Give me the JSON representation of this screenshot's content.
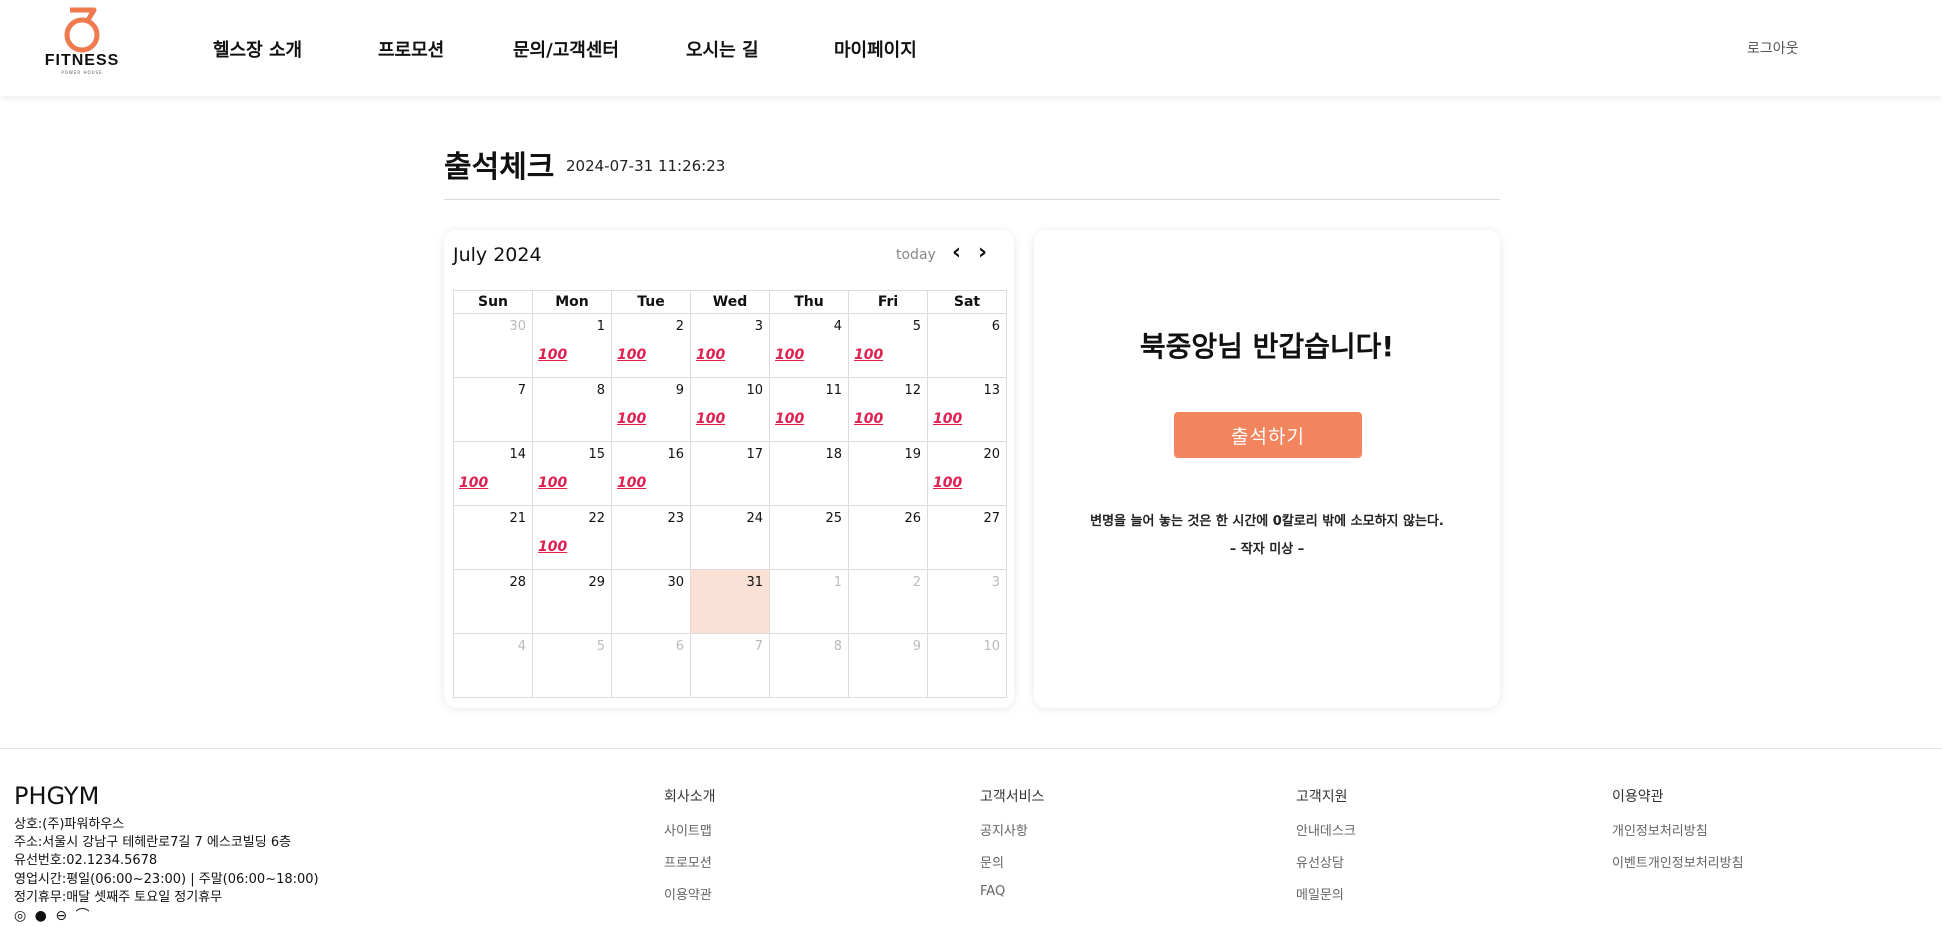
{
  "header": {
    "logo_text": "FITNESS",
    "logo_sub": "POWER HOUSE",
    "nav": [
      "헬스장 소개",
      "프로모션",
      "문의/고객센터",
      "오시는 길",
      "마이페이지"
    ],
    "logout": "로그아웃"
  },
  "page": {
    "title": "출석체크",
    "datetime": "2024-07-31 11:26:23"
  },
  "calendar": {
    "month_label": "July 2024",
    "today_label": "today",
    "prev_icon": "‹",
    "next_icon": "›",
    "weekdays": [
      "Sun",
      "Mon",
      "Tue",
      "Wed",
      "Thu",
      "Fri",
      "Sat"
    ],
    "stamp_text": "100",
    "weeks": [
      [
        {
          "d": "30",
          "o": true
        },
        {
          "d": "1",
          "s": true
        },
        {
          "d": "2",
          "s": true
        },
        {
          "d": "3",
          "s": true
        },
        {
          "d": "4",
          "s": true
        },
        {
          "d": "5",
          "s": true
        },
        {
          "d": "6"
        }
      ],
      [
        {
          "d": "7"
        },
        {
          "d": "8"
        },
        {
          "d": "9",
          "s": true
        },
        {
          "d": "10",
          "s": true
        },
        {
          "d": "11",
          "s": true
        },
        {
          "d": "12",
          "s": true
        },
        {
          "d": "13",
          "s": true
        }
      ],
      [
        {
          "d": "14",
          "s": true
        },
        {
          "d": "15",
          "s": true
        },
        {
          "d": "16",
          "s": true
        },
        {
          "d": "17"
        },
        {
          "d": "18"
        },
        {
          "d": "19"
        },
        {
          "d": "20",
          "s": true
        }
      ],
      [
        {
          "d": "21"
        },
        {
          "d": "22",
          "s": true
        },
        {
          "d": "23"
        },
        {
          "d": "24"
        },
        {
          "d": "25"
        },
        {
          "d": "26"
        },
        {
          "d": "27"
        }
      ],
      [
        {
          "d": "28"
        },
        {
          "d": "29"
        },
        {
          "d": "30"
        },
        {
          "d": "31",
          "t": true
        },
        {
          "d": "1",
          "o": true
        },
        {
          "d": "2",
          "o": true
        },
        {
          "d": "3",
          "o": true
        }
      ],
      [
        {
          "d": "4",
          "o": true
        },
        {
          "d": "5",
          "o": true
        },
        {
          "d": "6",
          "o": true
        },
        {
          "d": "7",
          "o": true
        },
        {
          "d": "8",
          "o": true
        },
        {
          "d": "9",
          "o": true
        },
        {
          "d": "10",
          "o": true
        }
      ]
    ]
  },
  "greeting": {
    "title": "북중앙님 반갑습니다!",
    "button": "출석하기",
    "quote": "변명을 늘어 놓는 것은 한 시간에 0칼로리 밖에 소모하지 않는다.",
    "author": "– 작자 미상 –"
  },
  "footer": {
    "brand": "PHGYM",
    "info": [
      "상호:(주)파워하우스",
      "주소:서울시 강남구 테헤란로7길 7 에스코빌딩 6층",
      "유선번호:02.1234.5678",
      "영업시간:평일(06:00~23:00) | 주말(06:00~18:00)",
      "정기휴무:매달 셋째주 토요일 정기휴무"
    ],
    "social_icons": [
      "instagram-icon",
      "github-icon",
      "car-icon",
      "bird-icon"
    ],
    "columns": [
      {
        "title": "회사소개",
        "links": [
          "사이트맵",
          "프로모션",
          "이용약관"
        ]
      },
      {
        "title": "고객서비스",
        "links": [
          "공지사항",
          "문의",
          "FAQ"
        ]
      },
      {
        "title": "고객지원",
        "links": [
          "안내데스크",
          "유선상담",
          "메일문의"
        ]
      },
      {
        "title": "이용약관",
        "links": [
          "개인정보처리방침",
          "이벤트개인정보처리방침"
        ]
      }
    ]
  },
  "colors": {
    "accent": "#f2855d",
    "today_bg": "#fbe0d6",
    "stamp": "#e0204f"
  }
}
